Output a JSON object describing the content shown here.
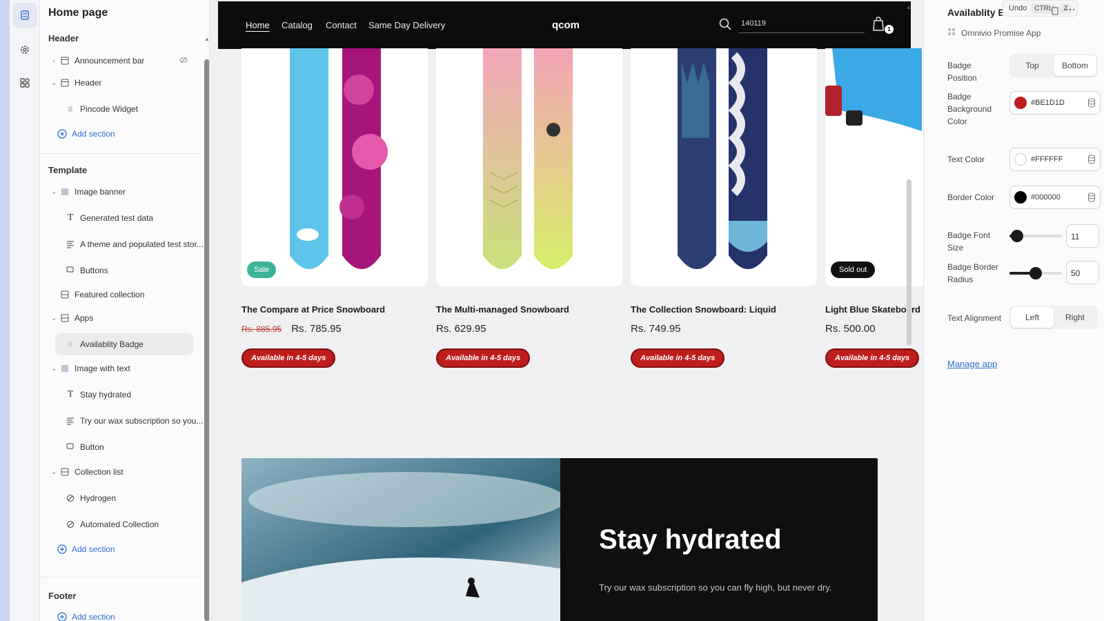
{
  "sidebar": {
    "page_title": "Home page",
    "header_label": "Header",
    "template_label": "Template",
    "footer_label": "Footer",
    "items": [
      {
        "label": "Announcement bar"
      },
      {
        "label": "Header"
      },
      {
        "label": "Pincode Widget"
      },
      {
        "label": "Add section"
      },
      {
        "label": "Image banner"
      },
      {
        "label": "Generated test data"
      },
      {
        "label": "A theme and populated test stor..."
      },
      {
        "label": "Buttons"
      },
      {
        "label": "Featured collection"
      },
      {
        "label": "Apps"
      },
      {
        "label": "Availablity Badge"
      },
      {
        "label": "Image with text"
      },
      {
        "label": "Stay hydrated"
      },
      {
        "label": "Try our wax subscription so you..."
      },
      {
        "label": "Button"
      },
      {
        "label": "Collection list"
      },
      {
        "label": "Hydrogen"
      },
      {
        "label": "Automated Collection"
      },
      {
        "label": "Add section"
      },
      {
        "label": "Add section"
      }
    ]
  },
  "store": {
    "nav": [
      "Home",
      "Catalog",
      "Contact",
      "Same Day Delivery"
    ],
    "brand": "qcom",
    "pincode": "140119",
    "cart_count": "1",
    "products": [
      {
        "title": "The Compare at Price Snowboard",
        "old_price": "Rs. 885.95",
        "price": "Rs. 785.95",
        "badge": "Available in 4-5 days",
        "tag": "Sale"
      },
      {
        "title": "The Multi-managed Snowboard",
        "old_price": "",
        "price": "Rs. 629.95",
        "badge": "Available in 4-5 days",
        "tag": ""
      },
      {
        "title": "The Collection Snowboard: Liquid",
        "old_price": "",
        "price": "Rs. 749.95",
        "badge": "Available in 4-5 days",
        "tag": ""
      },
      {
        "title": "Light Blue Skateboard",
        "old_price": "",
        "price": "Rs. 500.00",
        "badge": "Available in 4-5 days",
        "tag": "Sold out"
      }
    ],
    "hero": {
      "title": "Stay hydrated",
      "text": "Try our wax subscription so you can fly high, but never dry."
    }
  },
  "panel": {
    "title": "Availablity Badge",
    "undo_label": "Undo",
    "undo_key1": "CTRL",
    "undo_key2": "Z",
    "app_name": "Omnivio Promise App",
    "badge_position_label": "Badge Position",
    "position_options": [
      "Top",
      "Bottom"
    ],
    "position_selected": "Bottom",
    "bg_color_label": "Badge Background Color",
    "bg_color": "#BE1D1D",
    "text_color_label": "Text Color",
    "text_color": "#FFFFFF",
    "border_color_label": "Border Color",
    "border_color": "#000000",
    "font_size_label": "Badge Font Size",
    "font_size": "11",
    "font_size_fraction": 0.15,
    "radius_label": "Badge Border Radius",
    "radius": "50",
    "radius_fraction": 0.5,
    "align_label": "Text Alignment",
    "align_options": [
      "Left",
      "Right"
    ],
    "align_selected": "Left",
    "manage_link": "Manage app"
  }
}
